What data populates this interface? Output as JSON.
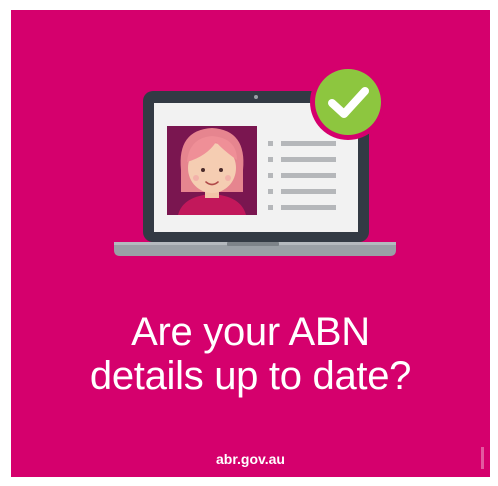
{
  "poster": {
    "headline_line1": "Are your ABN",
    "headline_line2": "details up to date?",
    "website": "abr.gov.au"
  },
  "illustration": {
    "device": "laptop-icon",
    "profile": "avatar-icon",
    "badge": "check-circle-icon",
    "list_lines": 5
  },
  "colors": {
    "background": "#d5006d",
    "laptop_frame": "#333a44",
    "laptop_base": "#9aa0a6",
    "screen": "#f2f2f2",
    "photo_frame": "#7a1650",
    "check_badge": "#8dc63f",
    "list_lines": "#b5b7ba",
    "text": "#ffffff"
  }
}
